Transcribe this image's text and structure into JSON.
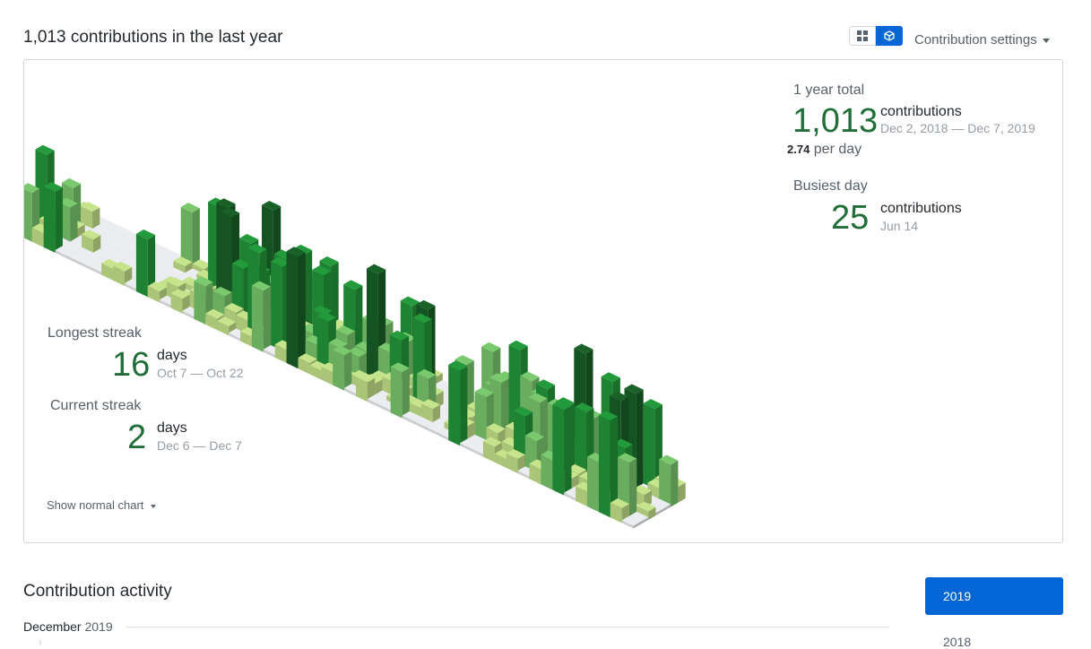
{
  "header": {
    "title": "1,013 contributions in the last year",
    "settings_label": "Contribution settings",
    "view_toggle": {
      "grid_icon": "grid-icon",
      "cube_icon": "cube-icon",
      "active": "cube"
    }
  },
  "stats": {
    "total": {
      "label": "1 year total",
      "value": "1,013",
      "unit": "contributions",
      "range": "Dec 2, 2018 — Dec 7, 2019",
      "per_day_value": "2.74",
      "per_day_label": "per day"
    },
    "busiest": {
      "label": "Busiest day",
      "value": "25",
      "unit": "contributions",
      "date": "Jun 14"
    },
    "longest": {
      "label": "Longest streak",
      "value": "16",
      "unit": "days",
      "range": "Oct 7 — Oct 22"
    },
    "current": {
      "label": "Current streak",
      "value": "2",
      "unit": "days",
      "range": "Dec 6 — Dec 7"
    }
  },
  "show_normal_chart": "Show normal chart",
  "activity": {
    "title": "Contribution activity",
    "month": "December",
    "year": "2019",
    "years": [
      "2019",
      "2018"
    ],
    "active_year": "2019"
  },
  "colors": {
    "empty": "#ebedf0",
    "level1": "#c6e48b",
    "level2": "#7bc96f",
    "level3": "#239a3b",
    "level4": "#196127",
    "accent": "#0366d6",
    "stat_green": "#216e39"
  }
}
